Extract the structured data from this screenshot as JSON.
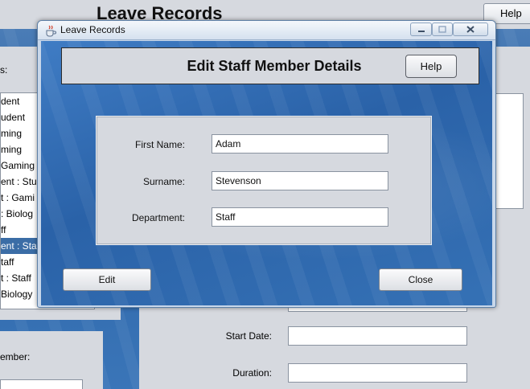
{
  "background_window": {
    "title": "Leave Records",
    "help_label": "Help",
    "left_label_suffix": "s:",
    "list_items": [
      "dent",
      "udent",
      "ming",
      "ming",
      " Gaming",
      "ent :  Stu",
      "t :  Gami",
      ":  Biolog",
      "ff",
      "ent :  Staf",
      "taff",
      "t :   Staff",
      " Biology"
    ],
    "selected_index": 9,
    "member_label": "ember:",
    "start_date_label": "Start Date:",
    "duration_label": "Duration:"
  },
  "dialog": {
    "title": "Leave Records",
    "heading": "Edit Staff Member Details",
    "help_label": "Help",
    "fields": [
      {
        "label": "First Name:",
        "value": "Adam"
      },
      {
        "label": "Surname:",
        "value": "Stevenson"
      },
      {
        "label": "Department:",
        "value": "Staff"
      }
    ],
    "edit_label": "Edit",
    "close_label": "Close"
  }
}
